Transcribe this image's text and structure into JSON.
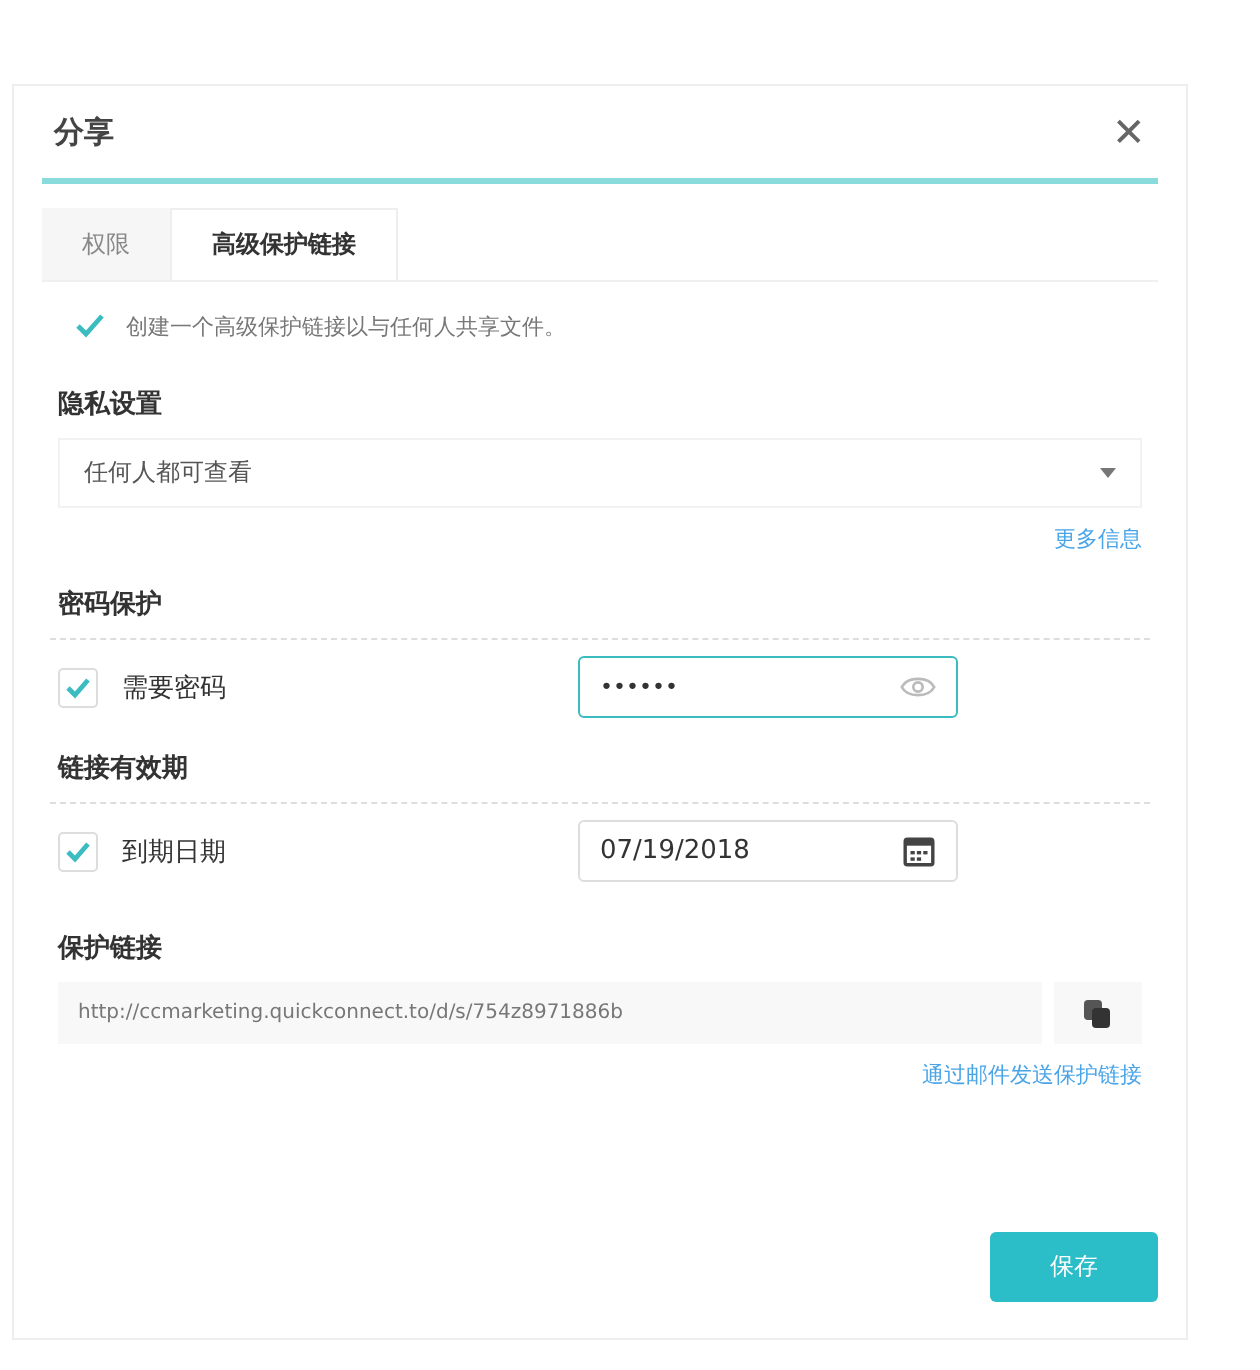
{
  "window": {
    "title": "分享",
    "close": "✕"
  },
  "tabs": [
    {
      "label": "权限",
      "selected": false
    },
    {
      "label": "高级保护链接",
      "selected": true
    }
  ],
  "enable": {
    "label": "创建一个高级保护链接以与任何人共享文件。",
    "checked": true
  },
  "privacy": {
    "heading": "隐私设置",
    "value": "任何人都可查看",
    "link": "更多信息"
  },
  "password": {
    "heading": "密码保护",
    "label": "需要密码",
    "checked": true,
    "value": "••••••"
  },
  "expiry": {
    "heading": "链接有效期",
    "label": "到期日期",
    "checked": true,
    "value": "07/19/2018"
  },
  "link": {
    "heading": "保护链接",
    "url": "http://ccmarketing.quickconnect.to/d/s/754z8971886b",
    "email_link": "通过邮件发送保护链接"
  },
  "buttons": [
    "保存"
  ]
}
